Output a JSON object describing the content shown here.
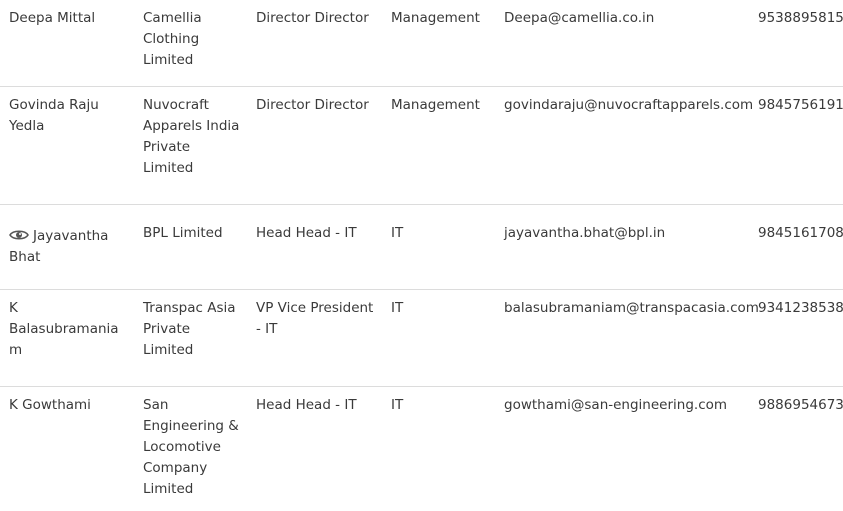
{
  "rows": [
    {
      "name": "Deepa Mittal",
      "company": "Camellia Clothing Limited",
      "title": "Director Director",
      "department": "Management",
      "email": "Deepa@camellia.co.in",
      "phone": "9538895815",
      "has_view_icon": false
    },
    {
      "name": "Govinda Raju Yedla",
      "company": "Nuvocraft Apparels India Private Limited",
      "title": "Director Director",
      "department": "Management",
      "email": "govindaraju@nuvocraftapparels.com",
      "phone": "9845756191",
      "has_view_icon": false
    },
    {
      "name": "Jayavantha Bhat",
      "company": "BPL Limited",
      "title": "Head Head - IT",
      "department": "IT",
      "email": "jayavantha.bhat@bpl.in",
      "phone": "9845161708",
      "has_view_icon": true,
      "view_icon": "eye-icon"
    },
    {
      "name": "K Balasubramaniam",
      "company": "Transpac Asia Private Limited",
      "title": "VP Vice President - IT",
      "department": "IT",
      "email": "balasubramaniam@transpacasia.com",
      "phone": "9341238538",
      "has_view_icon": false
    },
    {
      "name": "K Gowthami",
      "company": "San Engineering & Locomotive Company Limited",
      "title": "Head Head - IT",
      "department": "IT",
      "email": "gowthami@san-engineering.com",
      "phone": "9886954673",
      "has_view_icon": false
    }
  ]
}
